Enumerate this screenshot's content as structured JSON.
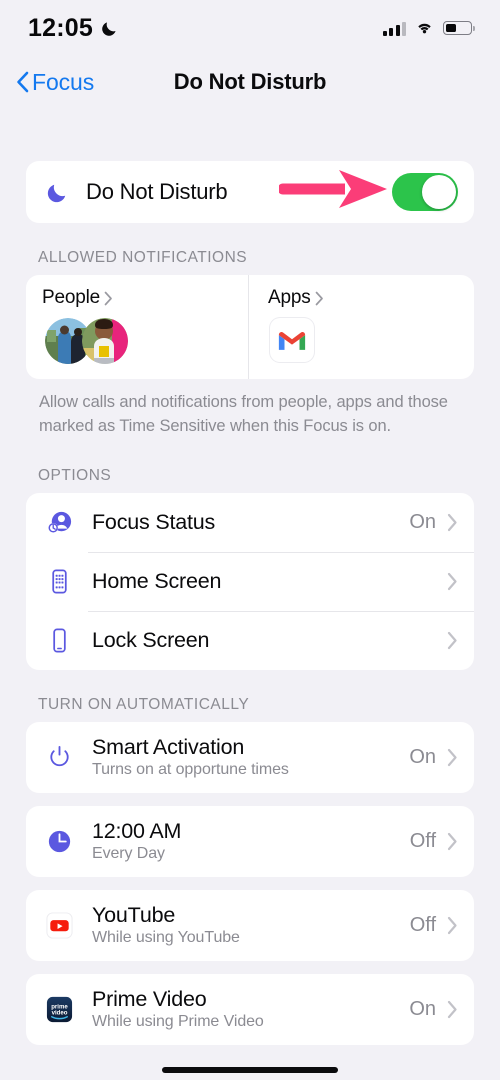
{
  "status_bar": {
    "time": "12:05",
    "moon_icon": "crescent-moon-icon",
    "signal_icon": "cellular-signal-icon",
    "signal_bars_filled": 3,
    "signal_bars_total": 4,
    "wifi_icon": "wifi-icon",
    "battery_icon": "battery-icon",
    "battery_percent": 42
  },
  "nav": {
    "back_icon": "chevron-left-icon",
    "back_label": "Focus",
    "title": "Do Not Disturb"
  },
  "focus_toggle": {
    "icon": "crescent-moon-icon",
    "label": "Do Not Disturb",
    "state": "on",
    "toggle_color": "#2cc44b"
  },
  "annotation": {
    "arrow_icon": "arrow-right-annotation",
    "color": "#fb3d78",
    "points_to": "do-not-disturb-toggle"
  },
  "allowed_notifications": {
    "header": "ALLOWED NOTIFICATIONS",
    "people": {
      "label": "People",
      "chevron_icon": "chevron-right-icon",
      "avatars": [
        "avatar-photo-adult",
        "avatar-photo-child"
      ]
    },
    "apps": {
      "label": "Apps",
      "chevron_icon": "chevron-right-icon",
      "apps": [
        "gmail-icon"
      ]
    },
    "footnote": "Allow calls and notifications from people, apps and those marked as Time Sensitive when this Focus is on."
  },
  "options": {
    "header": "OPTIONS",
    "items": [
      {
        "icon": "focus-status-icon",
        "title": "Focus Status",
        "value": "On",
        "chevron_icon": "chevron-right-icon"
      },
      {
        "icon": "home-screen-icon",
        "title": "Home Screen",
        "value": "",
        "chevron_icon": "chevron-right-icon"
      },
      {
        "icon": "lock-screen-icon",
        "title": "Lock Screen",
        "value": "",
        "chevron_icon": "chevron-right-icon"
      }
    ]
  },
  "turn_on_automatically": {
    "header": "TURN ON AUTOMATICALLY",
    "items": [
      {
        "icon": "power-icon",
        "title": "Smart Activation",
        "subtitle": "Turns on at opportune times",
        "value": "On",
        "chevron_icon": "chevron-right-icon"
      },
      {
        "icon": "clock-icon",
        "title": "12:00 AM",
        "subtitle": "Every Day",
        "value": "Off",
        "chevron_icon": "chevron-right-icon"
      },
      {
        "icon": "youtube-icon",
        "title": "YouTube",
        "subtitle": "While using YouTube",
        "value": "Off",
        "chevron_icon": "chevron-right-icon"
      },
      {
        "icon": "prime-video-icon",
        "title": "Prime Video",
        "subtitle": "While using Prime Video",
        "value": "On",
        "chevron_icon": "chevron-right-icon"
      }
    ]
  },
  "home_indicator": "home-indicator"
}
